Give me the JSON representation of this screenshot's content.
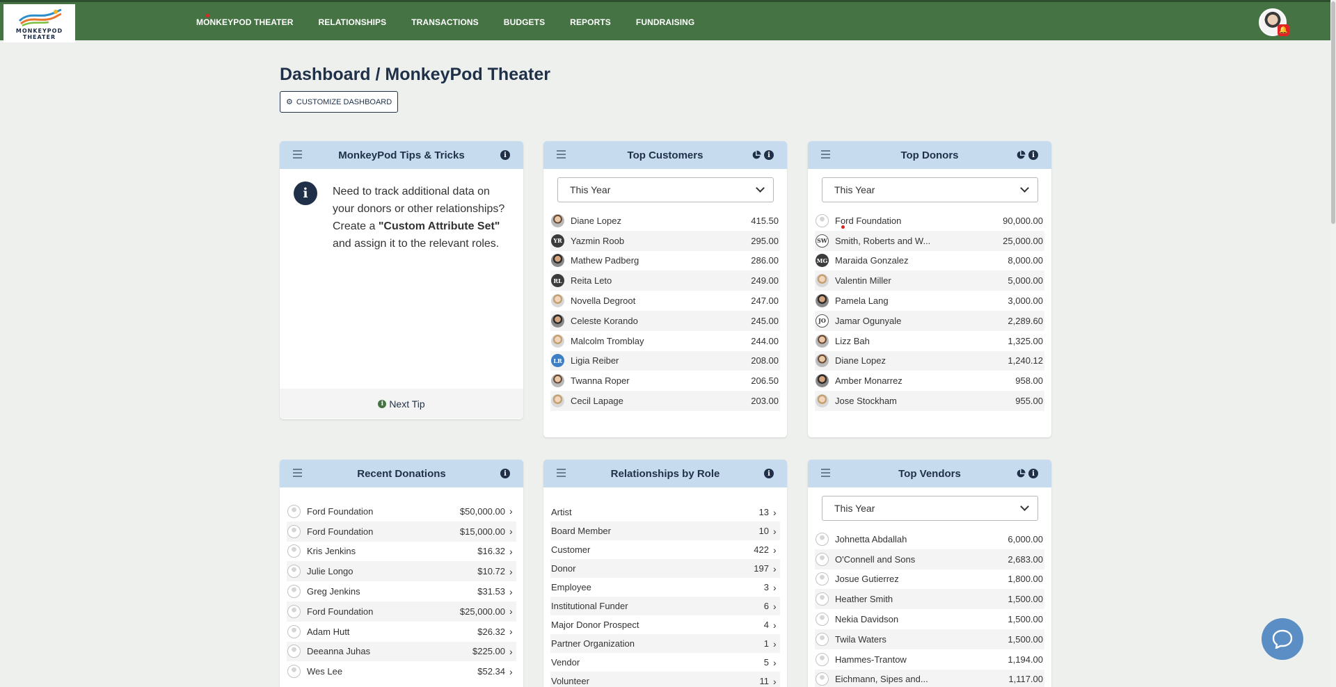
{
  "brand": {
    "line1": "MONKEYPOD",
    "line2": "THEATER"
  },
  "nav": [
    "MONKEYPOD THEATER",
    "RELATIONSHIPS",
    "TRANSACTIONS",
    "BUDGETS",
    "REPORTS",
    "FUNDRAISING"
  ],
  "header": {
    "title": "Dashboard / MonkeyPod Theater",
    "customize": "CUSTOMIZE DASHBOARD"
  },
  "tips": {
    "title": "MonkeyPod Tips & Tricks",
    "text_before": "Need to track additional data on your donors or other relationships? Create a ",
    "text_bold": "\"Custom Attribute Set\"",
    "text_after": " and assign it to the relevant roles.",
    "next": "Next Tip"
  },
  "top_customers": {
    "title": "Top Customers",
    "period": "This Year",
    "rows": [
      {
        "name": "Diane Lopez",
        "amount": "415.50",
        "av": "photo",
        "initials": ""
      },
      {
        "name": "Yazmin Roob",
        "amount": "295.00",
        "av": "dark",
        "initials": "YR"
      },
      {
        "name": "Mathew Padberg",
        "amount": "286.00",
        "av": "ph2",
        "initials": ""
      },
      {
        "name": "Reita Leto",
        "amount": "249.00",
        "av": "dark",
        "initials": "RL"
      },
      {
        "name": "Novella Degroot",
        "amount": "247.00",
        "av": "ph3",
        "initials": ""
      },
      {
        "name": "Celeste Korando",
        "amount": "245.00",
        "av": "ph2",
        "initials": ""
      },
      {
        "name": "Malcolm Tromblay",
        "amount": "244.00",
        "av": "ph3",
        "initials": ""
      },
      {
        "name": "Ligia Reiber",
        "amount": "208.00",
        "av": "blue",
        "initials": "LR"
      },
      {
        "name": "Twanna Roper",
        "amount": "206.50",
        "av": "photo",
        "initials": ""
      },
      {
        "name": "Cecil Lapage",
        "amount": "203.00",
        "av": "ph3",
        "initials": ""
      }
    ]
  },
  "top_donors": {
    "title": "Top Donors",
    "period": "This Year",
    "rows": [
      {
        "name": "Ford Foundation",
        "amount": "90,000.00",
        "av": "blank",
        "initials": ""
      },
      {
        "name": "Smith, Roberts and W...",
        "amount": "25,000.00",
        "av": "outline",
        "initials": "SW"
      },
      {
        "name": "Maraida Gonzalez",
        "amount": "8,000.00",
        "av": "dark",
        "initials": "MG"
      },
      {
        "name": "Valentin Miller",
        "amount": "5,000.00",
        "av": "ph3",
        "initials": ""
      },
      {
        "name": "Pamela Lang",
        "amount": "3,000.00",
        "av": "ph2",
        "initials": ""
      },
      {
        "name": "Jamar Ogunyale",
        "amount": "2,289.60",
        "av": "outline",
        "initials": "JO"
      },
      {
        "name": "Lizz Bah",
        "amount": "1,325.00",
        "av": "photo",
        "initials": ""
      },
      {
        "name": "Diane Lopez",
        "amount": "1,240.12",
        "av": "photo",
        "initials": ""
      },
      {
        "name": "Amber Monarrez",
        "amount": "958.00",
        "av": "ph2",
        "initials": ""
      },
      {
        "name": "Jose Stockham",
        "amount": "955.00",
        "av": "ph3",
        "initials": ""
      }
    ]
  },
  "recent_donations": {
    "title": "Recent Donations",
    "rows": [
      {
        "name": "Ford Foundation",
        "amount": "$50,000.00"
      },
      {
        "name": "Ford Foundation",
        "amount": "$15,000.00"
      },
      {
        "name": "Kris Jenkins",
        "amount": "$16.32"
      },
      {
        "name": "Julie Longo",
        "amount": "$10.72"
      },
      {
        "name": "Greg Jenkins",
        "amount": "$31.53"
      },
      {
        "name": "Ford Foundation",
        "amount": "$25,000.00"
      },
      {
        "name": "Adam Hutt",
        "amount": "$26.32"
      },
      {
        "name": "Deeanna Juhas",
        "amount": "$225.00"
      },
      {
        "name": "Wes Lee",
        "amount": "$52.34"
      }
    ]
  },
  "relationships_by_role": {
    "title": "Relationships by Role",
    "rows": [
      {
        "name": "Artist",
        "count": "13"
      },
      {
        "name": "Board Member",
        "count": "10"
      },
      {
        "name": "Customer",
        "count": "422"
      },
      {
        "name": "Donor",
        "count": "197"
      },
      {
        "name": "Employee",
        "count": "3"
      },
      {
        "name": "Institutional Funder",
        "count": "6"
      },
      {
        "name": "Major Donor Prospect",
        "count": "4"
      },
      {
        "name": "Partner Organization",
        "count": "1"
      },
      {
        "name": "Vendor",
        "count": "5"
      },
      {
        "name": "Volunteer",
        "count": "11"
      }
    ]
  },
  "top_vendors": {
    "title": "Top Vendors",
    "period": "This Year",
    "rows": [
      {
        "name": "Johnetta Abdallah",
        "amount": "6,000.00"
      },
      {
        "name": "O'Connell and Sons",
        "amount": "2,683.00"
      },
      {
        "name": "Josue Gutierrez",
        "amount": "1,800.00"
      },
      {
        "name": "Heather Smith",
        "amount": "1,500.00"
      },
      {
        "name": "Nekia Davidson",
        "amount": "1,500.00"
      },
      {
        "name": "Twila Waters",
        "amount": "1,500.00"
      },
      {
        "name": "Hammes-Trantow",
        "amount": "1,194.00"
      },
      {
        "name": "Eichmann, Sipes and...",
        "amount": "1,117.00"
      }
    ]
  },
  "colors": {
    "nav_bg": "#457344",
    "card_head": "#c7dbef",
    "ink": "#1f3048",
    "chat": "#5b8ec4"
  }
}
